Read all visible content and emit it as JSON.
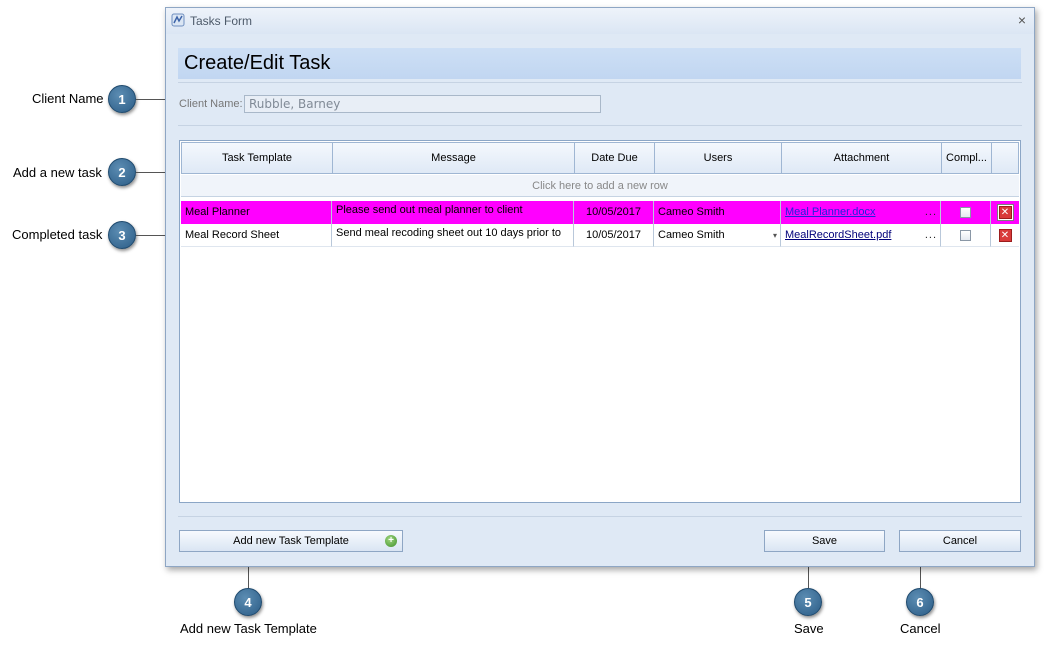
{
  "annotations": {
    "callouts": [
      {
        "number": "1",
        "label": "Client Name"
      },
      {
        "number": "2",
        "label": "Add a new task"
      },
      {
        "number": "3",
        "label": "Completed task"
      },
      {
        "number": "4",
        "label": "Add new Task Template"
      },
      {
        "number": "5",
        "label": "Save"
      },
      {
        "number": "6",
        "label": "Cancel"
      }
    ]
  },
  "window": {
    "title": "Tasks Form",
    "close_glyph": "×",
    "icon_name": "app-logo-icon"
  },
  "form": {
    "heading": "Create/Edit Task",
    "client_label": "Client Name:",
    "client_value": "Rubble, Barney"
  },
  "grid": {
    "columns": [
      "Task Template",
      "Message",
      "Date Due",
      "Users",
      "Attachment",
      "Compl...",
      ""
    ],
    "new_row_text": "Click here to add a new row",
    "highlight_color": "#ff00ff",
    "rows": [
      {
        "task_template": "Meal Planner",
        "message": "Please send out meal planner to client",
        "date_due": "10/05/2017",
        "users": "Cameo Smith",
        "attachment": "Meal Planner.docx",
        "attachment_more": "...",
        "completed": false
      },
      {
        "task_template": "Meal Record Sheet",
        "message": "Send meal recoding sheet out 10 days prior to",
        "date_due": "10/05/2017",
        "users": "Cameo Smith",
        "users_dropdown": "▾",
        "attachment": "MealRecordSheet.pdf",
        "attachment_more": "...",
        "completed": false
      }
    ]
  },
  "footer": {
    "add_template_label": "Add new Task Template",
    "add_icon": "+",
    "save_label": "Save",
    "cancel_label": "Cancel"
  }
}
